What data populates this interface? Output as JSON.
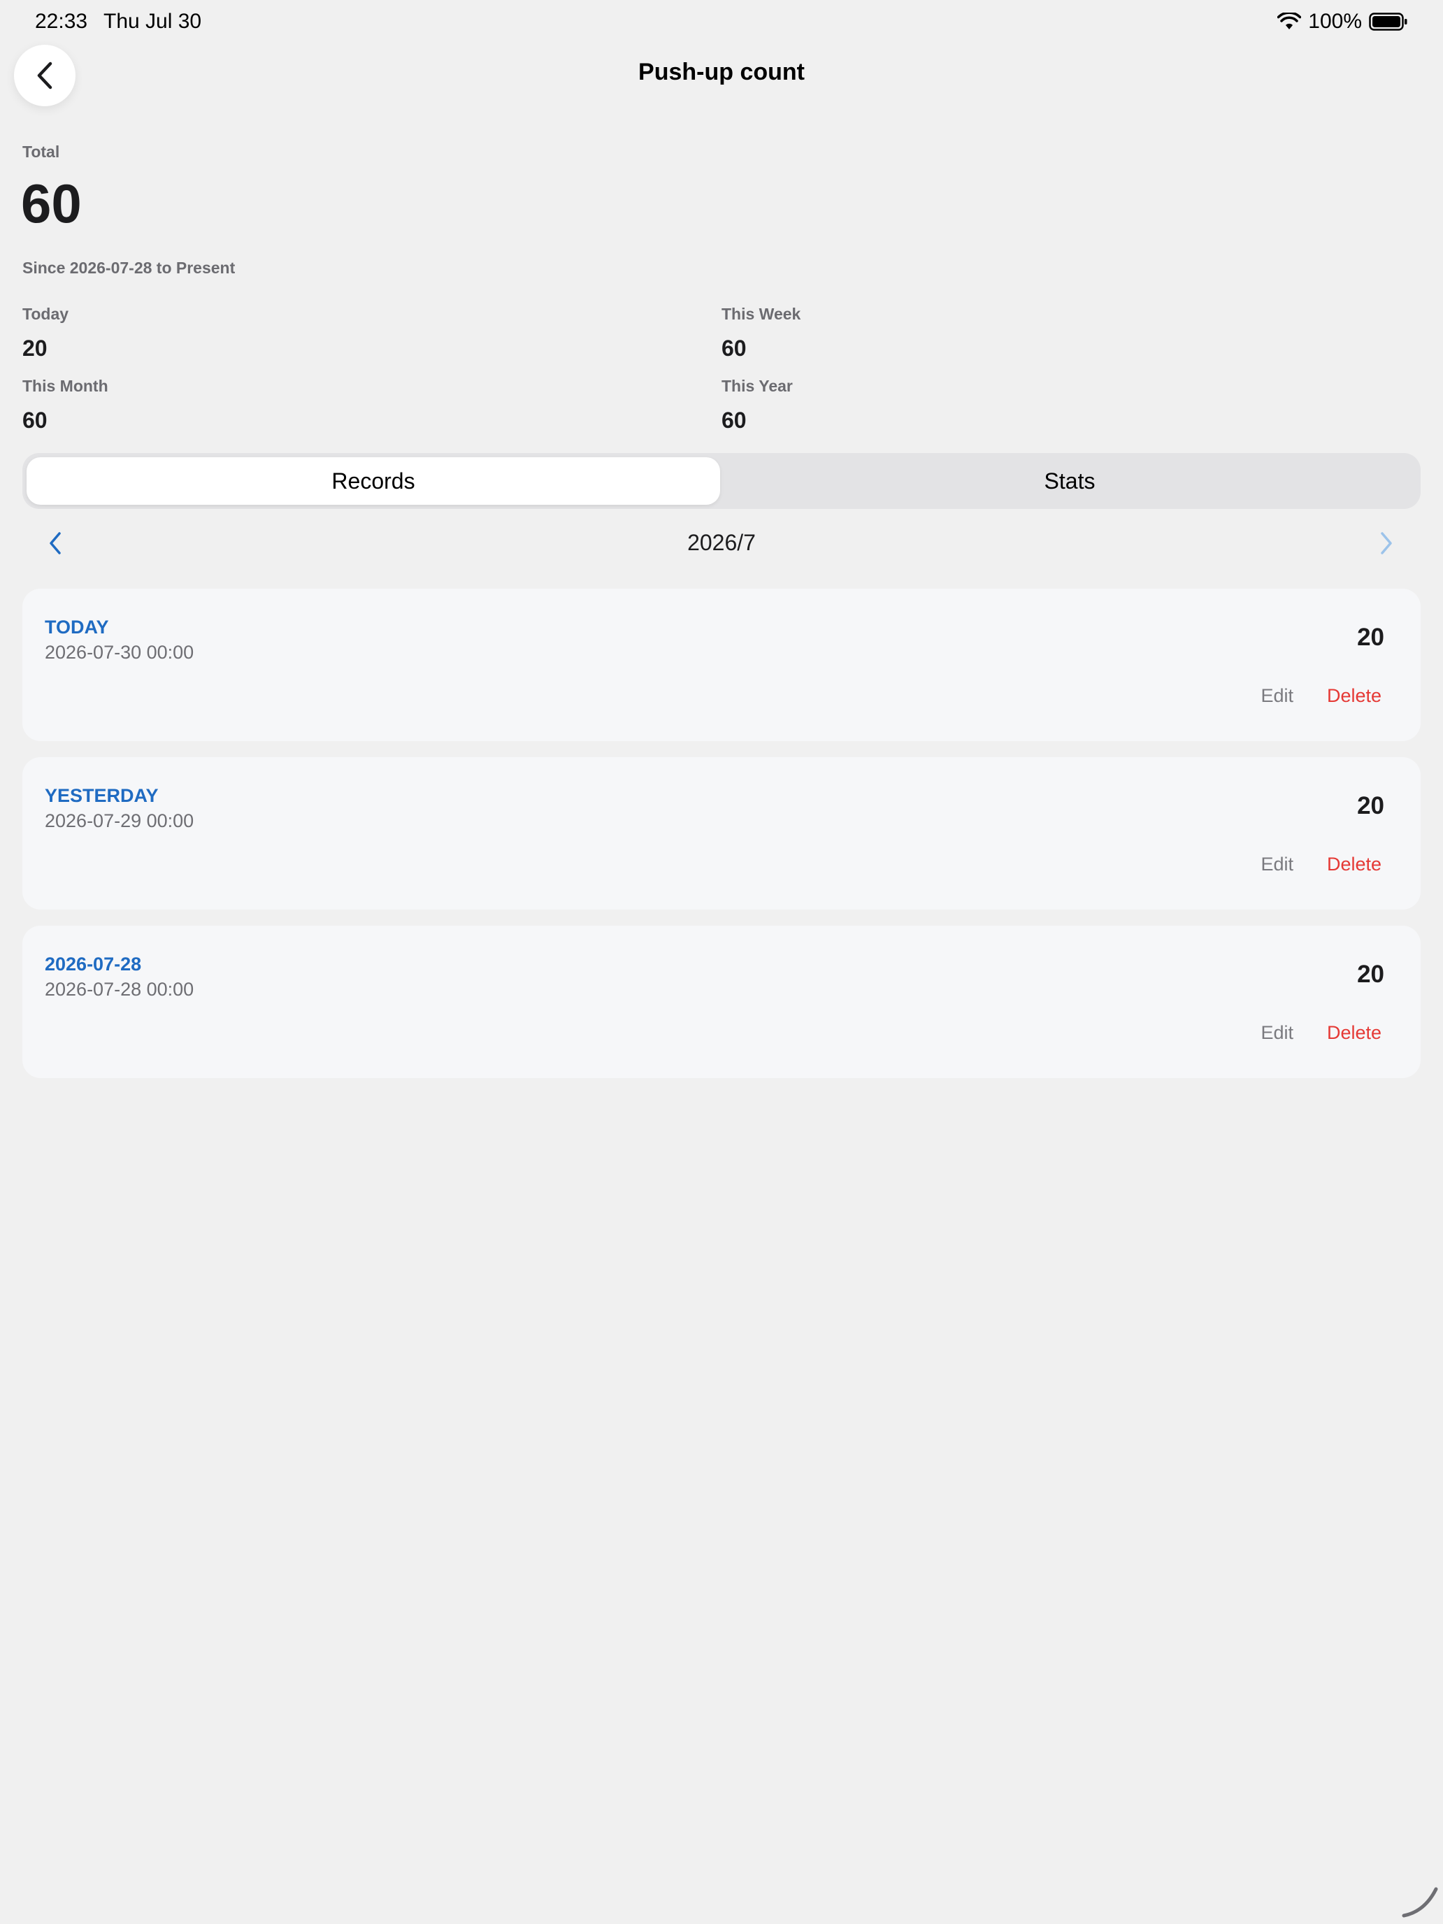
{
  "status_bar": {
    "time": "22:33",
    "date": "Thu Jul 30",
    "battery": "100%"
  },
  "header": {
    "title": "Push-up count",
    "back_icon": "chevron-left-icon"
  },
  "summary": {
    "total_label": "Total",
    "total_value": "60",
    "since_text": "Since 2026-07-28 to Present",
    "stats": [
      {
        "label": "Today",
        "value": "20"
      },
      {
        "label": "This Week",
        "value": "60"
      },
      {
        "label": "This Month",
        "value": "60"
      },
      {
        "label": "This Year",
        "value": "60"
      }
    ]
  },
  "tabs": [
    {
      "label": "Records",
      "active": true
    },
    {
      "label": "Stats",
      "active": false
    }
  ],
  "month_nav": {
    "label": "2026/7",
    "prev_icon": "chevron-left-icon",
    "next_icon": "chevron-right-icon"
  },
  "records": [
    {
      "title": "TODAY",
      "datetime": "2026-07-30 00:00",
      "count": "20",
      "edit": "Edit",
      "delete": "Delete"
    },
    {
      "title": "YESTERDAY",
      "datetime": "2026-07-29 00:00",
      "count": "20",
      "edit": "Edit",
      "delete": "Delete"
    },
    {
      "title": "2026-07-28",
      "datetime": "2026-07-28 00:00",
      "count": "20",
      "edit": "Edit",
      "delete": "Delete"
    }
  ],
  "colors": {
    "accent": "#1f6bc2",
    "danger": "#e53935",
    "background": "#f0f0f0",
    "card": "#f6f7f9"
  }
}
